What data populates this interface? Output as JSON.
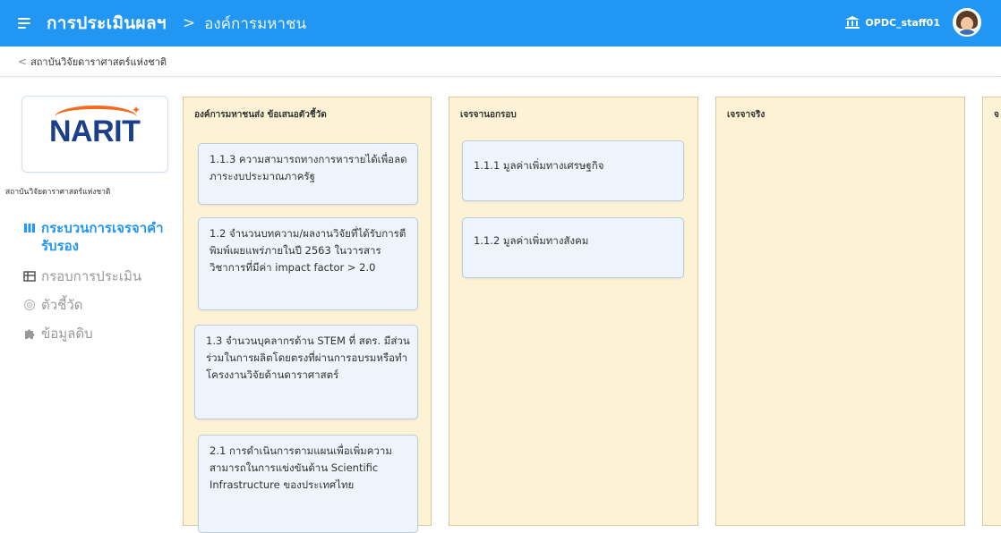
{
  "header": {
    "app_title": "การประเมินผลฯ",
    "separator": ">",
    "page_name": "องค์การมหาชน",
    "username": "OPDC_staff01"
  },
  "breadcrumb": {
    "back_label": "สถาบันวิจัยดาราศาสตร์แห่งชาติ"
  },
  "sidebar": {
    "logo_text": "NARIT",
    "institution_name": "สถาบันวิจัยดาราศาสตร์แห่งชาติ",
    "items": [
      {
        "label": "กระบวนการเจรจาคำรับรอง",
        "icon": "columns-icon",
        "active": true
      },
      {
        "label": "กรอบการประเมิน",
        "icon": "table-icon",
        "active": false
      },
      {
        "label": "ตัวชี้วัด",
        "icon": "target-icon",
        "active": false
      },
      {
        "label": "ข้อมูลดิบ",
        "icon": "puzzle-icon",
        "active": false
      }
    ]
  },
  "columns": [
    {
      "title": "องค์การมหาชนส่ง ข้อเสนอตัวชี้วัด",
      "cards": [
        "1.1.3 ความสามารถทางการหารายได้เพื่อลดภาระงบประมาณภาครัฐ",
        "1.2 จำนวนบทความ/ผลงานวิจัยที่ได้รับการตีพิมพ์เผยแพร่ภายในปี 2563 ในวารสารวิชาการที่มีค่า impact factor > 2.0",
        "1.3 จำนวนบุคลากรด้าน STEM ที่ สดร. มีส่วนร่วมในการผลิตโดยตรงที่ผ่านการอบรมหรือทำโครงงานวิจัยด้านดาราศาสตร์",
        "2.1 การดำเนินการตามแผนเพื่อเพิ่มความสามารถในการแข่งขันด้าน Scientific Infrastructure ของประเทศไทย"
      ]
    },
    {
      "title": "เจรจานอกรอบ",
      "cards": [
        "1.1.1 มูลค่าเพิ่มทางเศรษฐกิจ",
        "1.1.2 มูลค่าเพิ่มทางสังคม"
      ]
    },
    {
      "title": "เจรจาจริง",
      "cards": []
    },
    {
      "title": "จ",
      "cards": []
    }
  ],
  "colors": {
    "primary": "#2196f3",
    "column_bg": "#fdf3d4",
    "card_bg": "#eef4fb",
    "logo_blue": "#1b3f8b",
    "logo_orange": "#f26b21"
  }
}
